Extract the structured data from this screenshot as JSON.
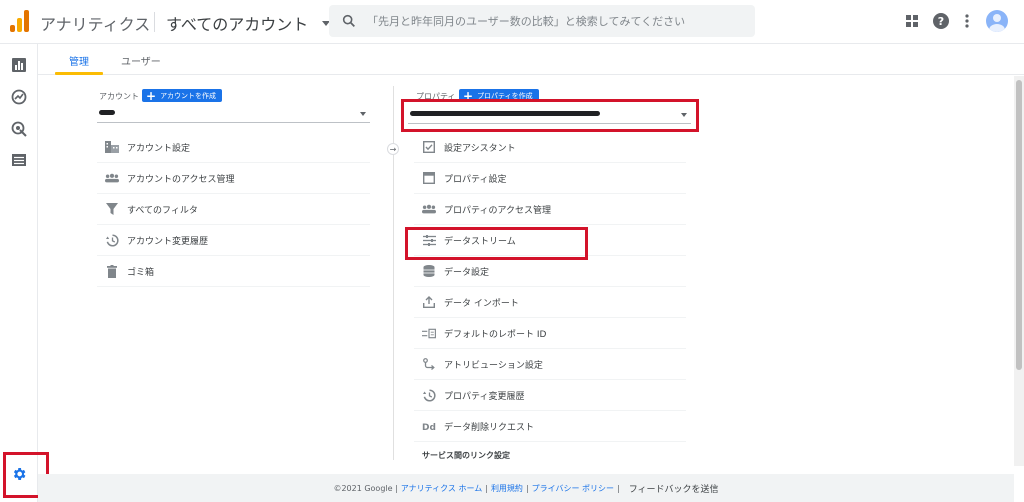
{
  "header": {
    "app_title": "アナリティクス",
    "account_picker": "すべてのアカウント",
    "search_placeholder": "「先月と昨年同月のユーザー数の比較」と検索してみてください",
    "icons": [
      "apps-grid-icon",
      "help-icon",
      "more-vert-icon",
      "avatar"
    ]
  },
  "rail": {
    "icons": [
      "reports-icon",
      "explore-icon",
      "advertising-icon",
      "configure-icon",
      "admin-gear-icon"
    ]
  },
  "tabs": [
    "管理",
    "ユーザー"
  ],
  "account_column": {
    "label": "アカウント",
    "create_button": "アカウントを作成",
    "items": [
      {
        "icon": "building-icon",
        "label": "アカウント設定"
      },
      {
        "icon": "people-icon",
        "label": "アカウントのアクセス管理"
      },
      {
        "icon": "filter-icon",
        "label": "すべてのフィルタ"
      },
      {
        "icon": "history-icon",
        "label": "アカウント変更履歴"
      },
      {
        "icon": "trash-icon",
        "label": "ゴミ箱"
      }
    ]
  },
  "property_column": {
    "label": "プロパティ",
    "create_button": "プロパティを作成",
    "items": [
      {
        "icon": "checklist-icon",
        "label": "設定アシスタント"
      },
      {
        "icon": "property-icon",
        "label": "プロパティ設定"
      },
      {
        "icon": "people-icon",
        "label": "プロパティのアクセス管理"
      },
      {
        "icon": "data-streams-icon",
        "label": "データストリーム"
      },
      {
        "icon": "database-icon",
        "label": "データ設定"
      },
      {
        "icon": "upload-icon",
        "label": "データ インポート"
      },
      {
        "icon": "report-id-icon",
        "label": "デフォルトのレポート ID"
      },
      {
        "icon": "attribution-icon",
        "label": "アトリビューション設定"
      },
      {
        "icon": "history-icon",
        "label": "プロパティ変更履歴"
      },
      {
        "icon": "data-deletion-icon",
        "label": "データ削除リクエスト"
      }
    ],
    "section_heading": "サービス間のリンク設定"
  },
  "footer": {
    "copyright": "©2021 Google |",
    "links": [
      "アナリティクス ホーム",
      "利用規約",
      "プライバシー ポリシー"
    ],
    "feedback": "フィードバックを送信"
  },
  "colors": {
    "accent": "#1a73e8",
    "highlight": "#d3132a",
    "tab_underline": "#fbbc04"
  }
}
